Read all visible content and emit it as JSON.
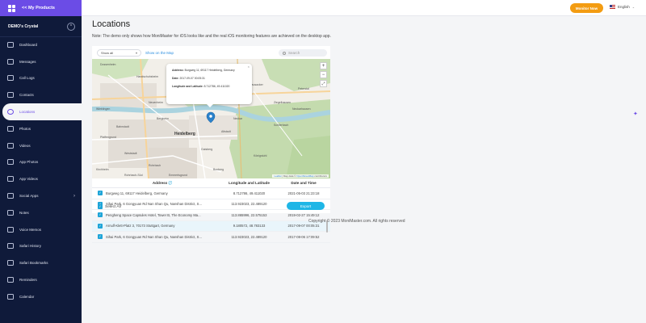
{
  "app": {
    "back_label": "<< My Products",
    "device_name": "DEMO's Crystal"
  },
  "sidebar": {
    "items": [
      {
        "label": "Dashboard"
      },
      {
        "label": "Messages"
      },
      {
        "label": "Call Logs"
      },
      {
        "label": "Contacts"
      },
      {
        "label": "Locations"
      },
      {
        "label": "Photos"
      },
      {
        "label": "Videos"
      },
      {
        "label": "App Photos"
      },
      {
        "label": "App Videos"
      },
      {
        "label": "Social Apps"
      },
      {
        "label": "Notes"
      },
      {
        "label": "Voice Memos"
      },
      {
        "label": "Safari History"
      },
      {
        "label": "Safari Bookmarks"
      },
      {
        "label": "Reminders"
      },
      {
        "label": "Calendar"
      }
    ]
  },
  "topbar": {
    "monitor_label": "Monitor Now",
    "language": "English",
    "accent": "#f39c12"
  },
  "page": {
    "title": "Locations",
    "note": "Note: The demo only shows how MoniMaster for iOS looks like and the real iOS monitoring features are achieved on the desktop app."
  },
  "toolbar": {
    "filter_value": "Show all",
    "show_on_map": "Show on the Map",
    "search_placeholder": "Search"
  },
  "map": {
    "popup": {
      "address_label": "Address:",
      "address": "Burgweg 11, 69117 Heidelberg, Germany",
      "date_label": "Date:",
      "date": "2017-09-07 00:05:31",
      "coords_label": "Longitude and Latitude:",
      "coords": "8.712786, 49.411020"
    },
    "labels": {
      "city": "Heidelberg",
      "altstadt": "Altstadt",
      "neuenheim": "Neuenheim",
      "handschuhsheim": "Handschuhsheim",
      "heiligenberg": "Heiligenberg",
      "rohrbach": "Rohrbach",
      "kirchheim": "Kirchheim",
      "pfaffengrund": "Pfaffengrund",
      "weststadt": "Weststadt",
      "schlierbach": "Schlierbach",
      "ziegelhausen": "Ziegelhausen",
      "peterstal": "Peterstal",
      "dossenheim": "Dossenheim",
      "neckarhausen": "Neckarhausen",
      "wieblingen": "Wieblingen",
      "bahnstadt": "Bahnstadt",
      "emmertsgrund": "Emmertsgrund",
      "boxberg": "Boxberg",
      "bergheim": "Bergheim",
      "neckar": "Neckar",
      "konigstuhl": "Königstuhl",
      "gaisberg": "Gaisberg",
      "hausacker": "Hausacker",
      "rohrbach_sud": "Rohrbach-Süd"
    },
    "attribution_leaflet": "Leaflet",
    "attribution_text": " | Map data © ",
    "attribution_osm": "OpenStreetMap",
    "attribution_contrib": " contributors"
  },
  "table": {
    "headers": {
      "address": "Address",
      "coords": "Longitude and Latitude",
      "date": "Date and Time"
    },
    "rows": [
      {
        "address": "Burgweg 11, 69117 Heidelberg, Germany",
        "coords": "8.712786, 49.411020",
        "date": "2021-05-03 21:23:18",
        "highlight": false
      },
      {
        "address": "Sihai Park, 6 Gongyuan Rd Nan Shan Qu, Nanshan District, S...",
        "coords": "113.923023, 22.489120",
        "date": "2020-09-04 10:23:11",
        "highlight": false
      },
      {
        "address": "Pengheng Space Capsules Hotel, Tower B, The Economy Ma...",
        "coords": "113.865996, 22.575153",
        "date": "2019-02-27 15:49:12",
        "highlight": false
      },
      {
        "address": "Arnulf-Klett-Platz 3, 70173 Stuttgart, Germany",
        "coords": "9.180572, 48.783133",
        "date": "2017-09-07 00:05:31",
        "highlight": true
      },
      {
        "address": "Sihai Park, 6 Gongyuan Rd Nan Shan Qu, Nanshan District, S...",
        "coords": "113.923023, 22.489120",
        "date": "2017-08-06 17:09:52",
        "highlight": false
      }
    ],
    "select_all": "Select All",
    "export_label": "Export"
  },
  "footer": {
    "copyright": "Copyright © 2023 MoniMaster.com. All rights reserved"
  }
}
